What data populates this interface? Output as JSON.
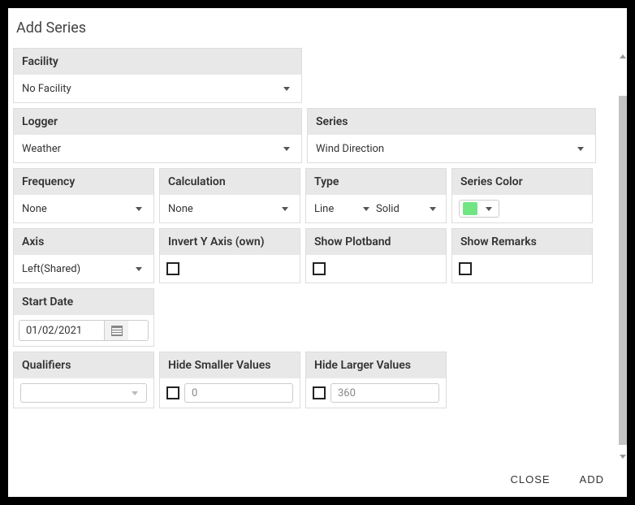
{
  "title": "Add Series",
  "facility": {
    "label": "Facility",
    "value": "No Facility"
  },
  "logger": {
    "label": "Logger",
    "value": "Weather"
  },
  "series": {
    "label": "Series",
    "value": "Wind Direction"
  },
  "frequency": {
    "label": "Frequency",
    "value": "None"
  },
  "calculation": {
    "label": "Calculation",
    "value": "None"
  },
  "type": {
    "label": "Type",
    "chart": "Line",
    "style": "Solid"
  },
  "seriesColor": {
    "label": "Series Color",
    "hex": "#71e583"
  },
  "axis": {
    "label": "Axis",
    "value": "Left(Shared)"
  },
  "invertY": {
    "label": "Invert Y Axis (own)",
    "checked": false
  },
  "showPlotband": {
    "label": "Show Plotband",
    "checked": false
  },
  "showRemarks": {
    "label": "Show Remarks",
    "checked": false
  },
  "startDate": {
    "label": "Start Date",
    "value": "01/02/2021"
  },
  "qualifiers": {
    "label": "Qualifiers",
    "value": ""
  },
  "hideSmaller": {
    "label": "Hide Smaller Values",
    "checked": false,
    "value": "0"
  },
  "hideLarger": {
    "label": "Hide Larger Values",
    "checked": false,
    "value": "360"
  },
  "actions": {
    "close": "CLOSE",
    "add": "ADD"
  }
}
